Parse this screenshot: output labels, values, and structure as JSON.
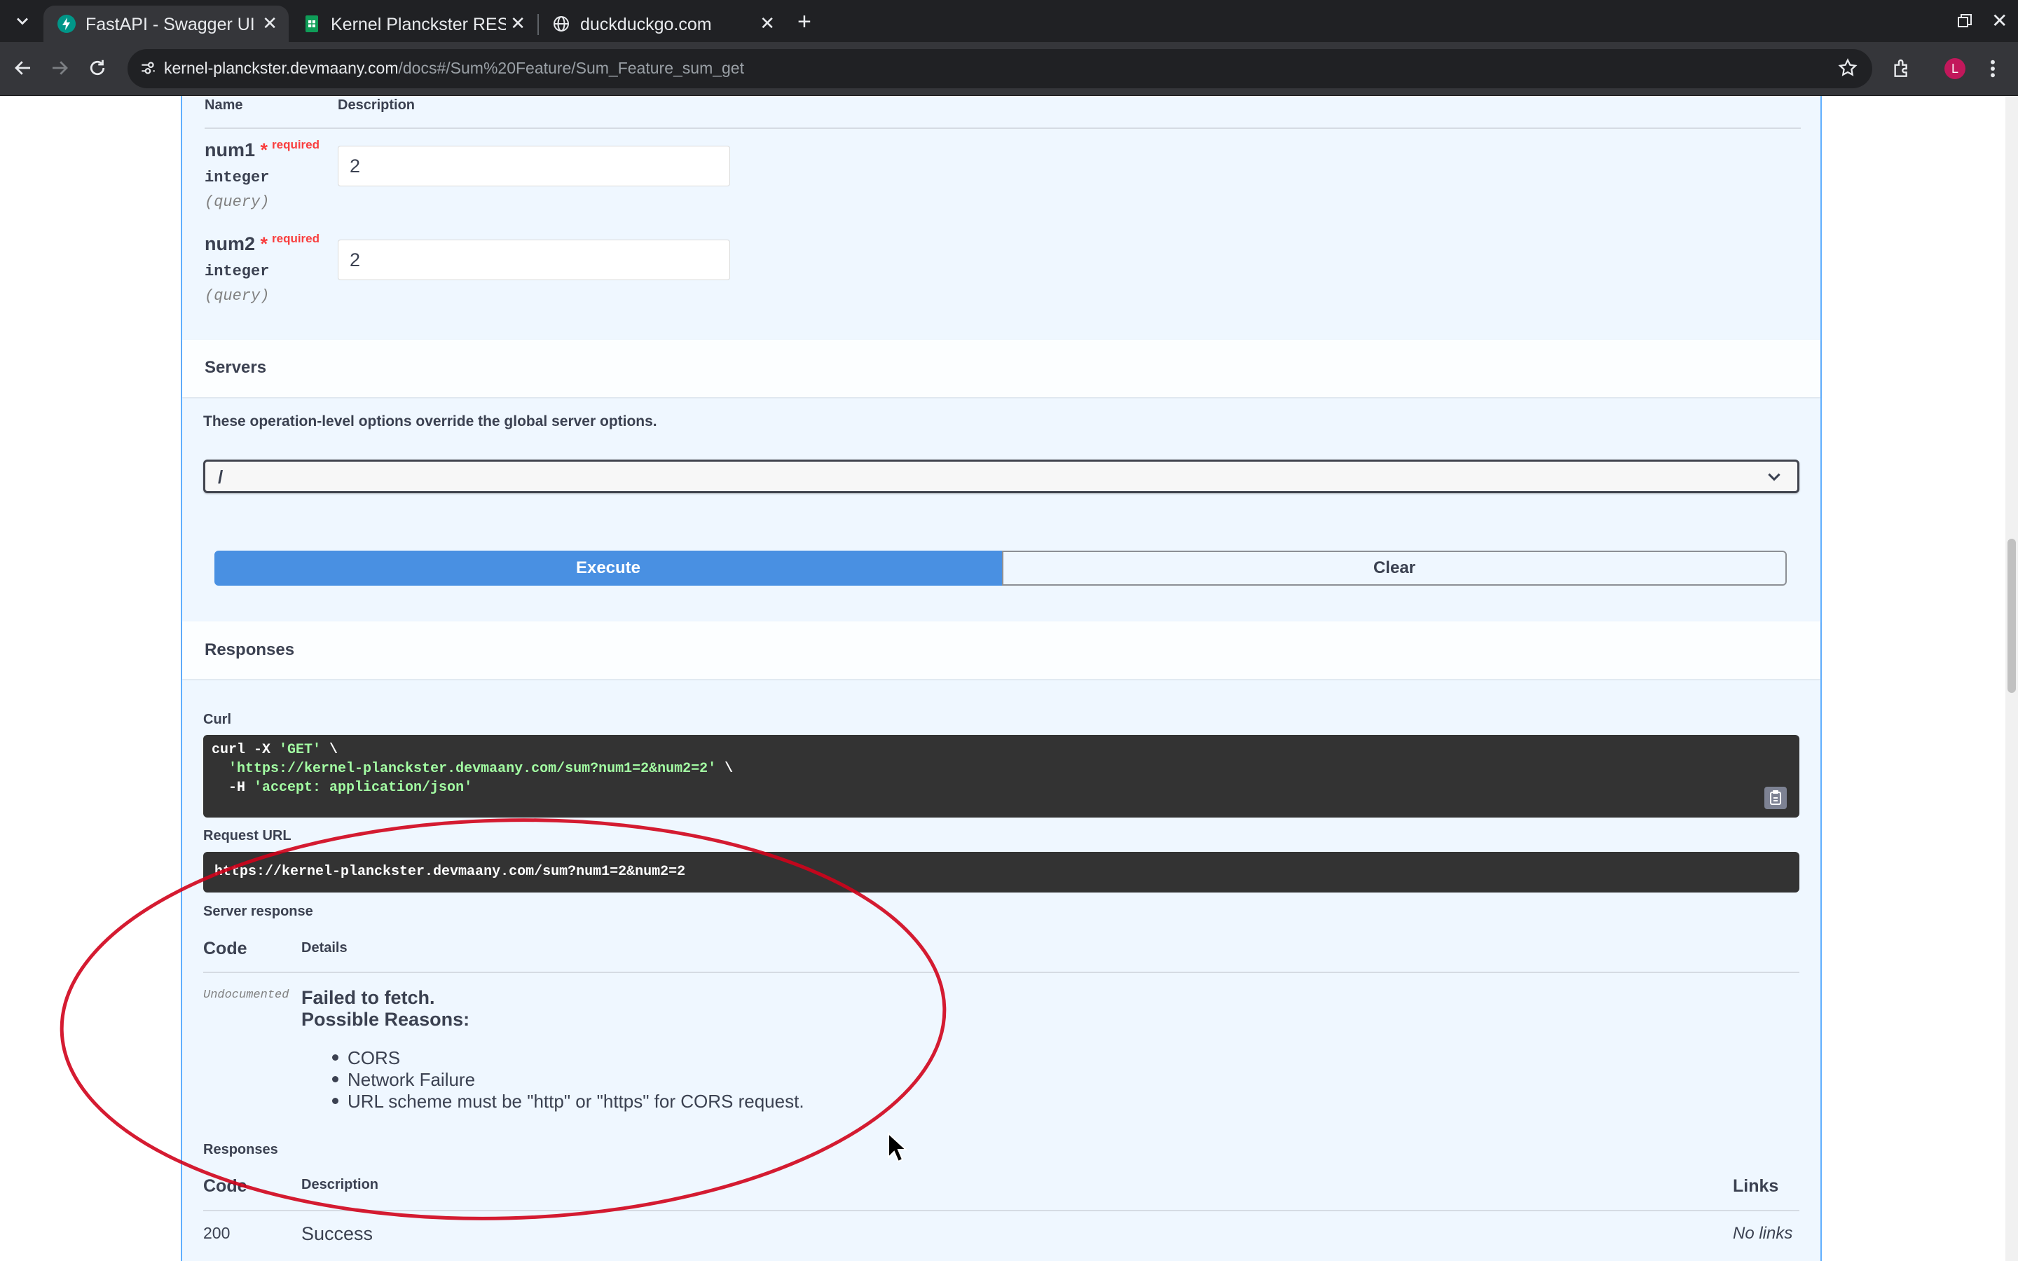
{
  "browser": {
    "tabs": [
      {
        "title": "FastAPI - Swagger UI",
        "active": true,
        "favicon": "fastapi-icon"
      },
      {
        "title": "Kernel Planckster RES",
        "active": false,
        "favicon": "sheets-icon"
      },
      {
        "title": "duckduckgo.com",
        "active": false,
        "favicon": "globe-icon"
      }
    ],
    "address": {
      "host": "kernel-planckster.devmaany.com",
      "path": "/docs#/Sum%20Feature/Sum_Feature_sum_get"
    },
    "profile_initial": "L",
    "profile_color": "#c2185b"
  },
  "parameters": {
    "col_name": "Name",
    "col_description": "Description",
    "required_label": "required",
    "star": "*",
    "items": [
      {
        "name": "num1",
        "type": "integer",
        "in": "(query)",
        "value": "2"
      },
      {
        "name": "num2",
        "type": "integer",
        "in": "(query)",
        "value": "2"
      }
    ]
  },
  "servers": {
    "title": "Servers",
    "description": "These operation-level options override the global server options.",
    "selected": "/"
  },
  "actions": {
    "execute": "Execute",
    "clear": "Clear"
  },
  "responses_title": "Responses",
  "curl": {
    "label": "Curl",
    "line1_cmd": "curl -X ",
    "line1_str": "'GET'",
    "line1_end": " \\",
    "line2_str": "'https://kernel-planckster.devmaany.com/sum?num1=2&num2=2'",
    "line2_end": " \\",
    "line3_cmd": "  -H ",
    "line3_str": "'accept: application/json'"
  },
  "request_url": {
    "label": "Request URL",
    "value": "https://kernel-planckster.devmaany.com/sum?num1=2&num2=2"
  },
  "server_response": {
    "label": "Server response",
    "col_code": "Code",
    "col_details": "Details",
    "code": "Undocumented",
    "error_title": "Failed to fetch.",
    "error_subtitle": "Possible Reasons:",
    "reasons": [
      "CORS",
      "Network Failure",
      "URL scheme must be \"http\" or \"https\" for CORS request."
    ]
  },
  "responses_table": {
    "label": "Responses",
    "col_code": "Code",
    "col_description": "Description",
    "col_links": "Links",
    "rows": [
      {
        "code": "200",
        "description": "Success",
        "links": "No links"
      }
    ]
  },
  "colors": {
    "accent_get": "#61affe",
    "execute_button": "#4990e2",
    "required": "#f93e3e",
    "annotation_circle": "#d0021b"
  }
}
